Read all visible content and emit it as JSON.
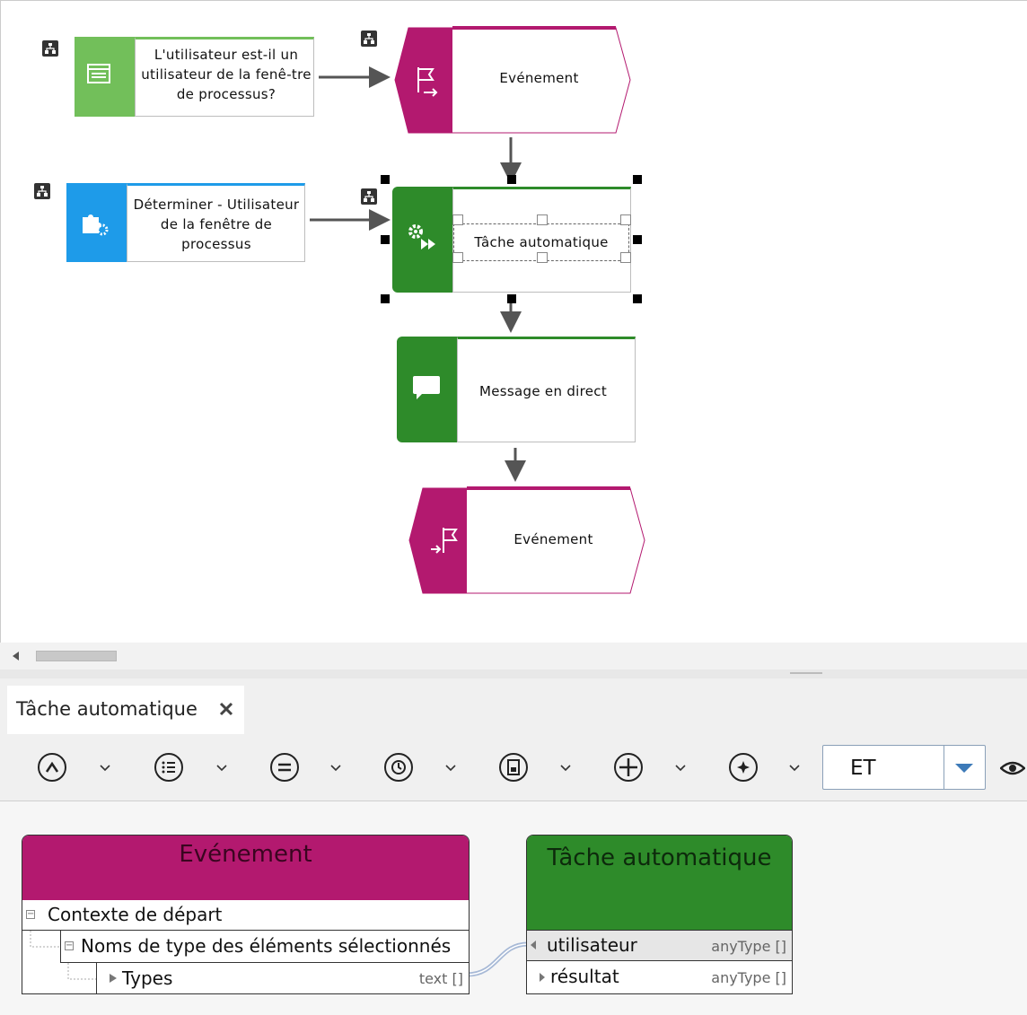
{
  "canvas": {
    "nodes": {
      "rule": {
        "label": "L'utilisateur est-il un utilisateur de la fenê-tre de processus?"
      },
      "event_start": {
        "label": "Evénement"
      },
      "function": {
        "label": "Déterminer - Utilisateur de la fenêtre de processus"
      },
      "task": {
        "label": "Tâche automatique"
      },
      "message": {
        "label": "Message en direct"
      },
      "event_end": {
        "label": "Evénement"
      }
    }
  },
  "tab": {
    "label": "Tâche automatique"
  },
  "toolbar": {
    "operator_select": {
      "value": "ET"
    }
  },
  "detail": {
    "event_box": {
      "title": "Evénement",
      "rows": [
        {
          "label": "Contexte de départ"
        },
        {
          "label": "Noms de type des éléments sélectionnés"
        },
        {
          "label": "Types",
          "type": "text []"
        }
      ]
    },
    "task_box": {
      "title": "Tâche automatique",
      "rows": [
        {
          "label": "utilisateur",
          "type": "anyType []"
        },
        {
          "label": "résultat",
          "type": "anyType []"
        }
      ]
    }
  },
  "colors": {
    "event": "#b3196f",
    "task_green": "#2e8b2a",
    "rule_green": "#72bf5a",
    "function_blue": "#1e9be9"
  },
  "icons": [
    "rule-icon",
    "start-event-icon",
    "function-icon",
    "automatic-task-icon",
    "message-icon",
    "end-event-icon",
    "assignment-icon",
    "close-icon",
    "eye-icon"
  ]
}
